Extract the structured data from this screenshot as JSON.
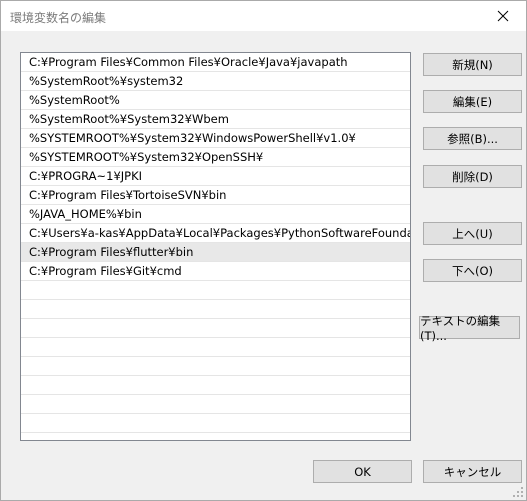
{
  "window": {
    "title": "環境変数名の編集",
    "close_icon": "close-icon"
  },
  "paths": [
    "C:¥Program Files¥Common Files¥Oracle¥Java¥javapath",
    "%SystemRoot%¥system32",
    "%SystemRoot%",
    "%SystemRoot%¥System32¥Wbem",
    "%SYSTEMROOT%¥System32¥WindowsPowerShell¥v1.0¥",
    "%SYSTEMROOT%¥System32¥OpenSSH¥",
    "C:¥PROGRA~1¥JPKI",
    "C:¥Program Files¥TortoiseSVN¥bin",
    "%JAVA_HOME%¥bin",
    "C:¥Users¥a-kas¥AppData¥Local¥Packages¥PythonSoftwareFoundation...",
    "C:¥Program Files¥flutter¥bin",
    "C:¥Program Files¥Git¥cmd"
  ],
  "selected_index": 10,
  "buttons": {
    "new": "新規(N)",
    "edit": "編集(E)",
    "browse": "参照(B)...",
    "delete": "削除(D)",
    "move_up": "上へ(U)",
    "move_down": "下へ(O)",
    "edit_text": "テキストの編集(T)...",
    "ok": "OK",
    "cancel": "キャンセル"
  },
  "colors": {
    "accent_border": "#828790",
    "selection": "#e8e8e8"
  }
}
